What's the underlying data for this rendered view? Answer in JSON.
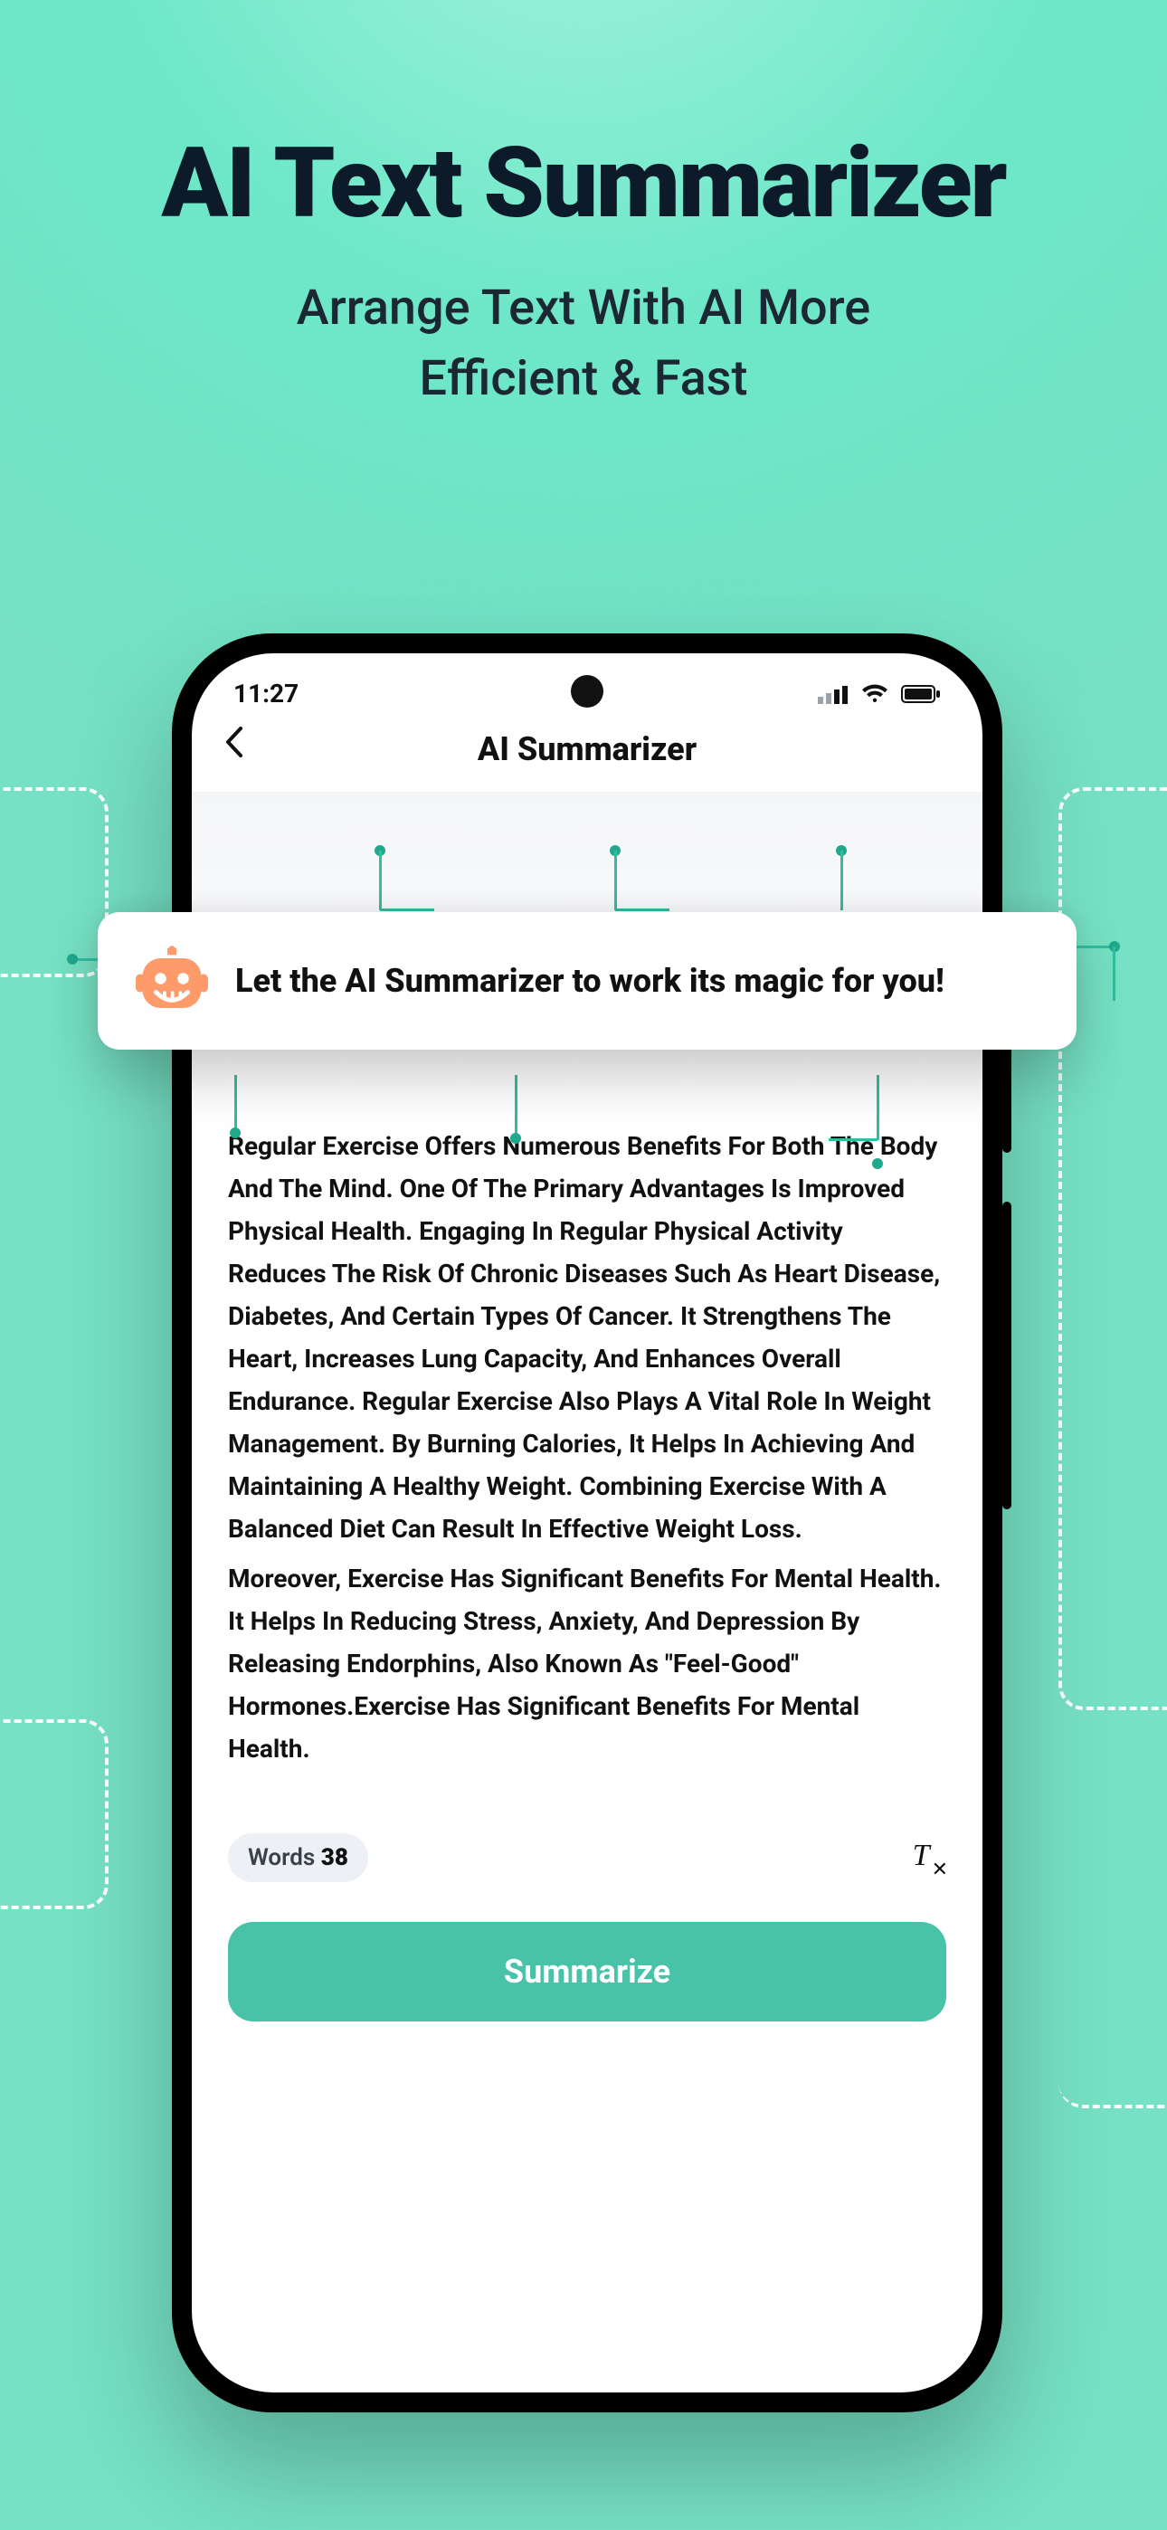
{
  "promo": {
    "title": "AI Text Summarizer",
    "subtitle_line1": "Arrange Text With AI More",
    "subtitle_line2": "Efficient & Fast"
  },
  "hint": {
    "icon_name": "robot-icon",
    "text": "Let the AI Summarizer to work its magic for you!"
  },
  "phone": {
    "status": {
      "time": "11:27"
    },
    "header": {
      "title": "AI Summarizer",
      "back_label": "Back"
    },
    "content": {
      "paragraph1": "Regular Exercise Offers Numerous Benefits For Both The Body And The Mind. One Of The Primary Advantages Is Improved Physical Health. Engaging In Regular Physical Activity Reduces The Risk Of Chronic Diseases Such As Heart Disease, Diabetes, And Certain Types Of Cancer. It Strengthens The Heart, Increases Lung Capacity, And Enhances Overall Endurance. Regular Exercise Also Plays A Vital Role In Weight Management. By Burning Calories, It Helps In Achieving And Maintaining A Healthy Weight. Combining Exercise With A Balanced Diet Can Result In Effective Weight Loss.",
      "paragraph2": "Moreover, Exercise Has Significant Benefits For Mental Health. It Helps In Reducing Stress, Anxiety, And Depression By Releasing Endorphins, Also Known As \"Feel-Good\" Hormones.Exercise Has Significant Benefits For Mental Health."
    },
    "footer": {
      "word_label": "Words",
      "word_count": "38",
      "clear_tooltip": "Clear text",
      "summarize_label": "Summarize"
    }
  },
  "colors": {
    "accent": "#49c3a8",
    "brand_icon": "#ff8f5f"
  }
}
